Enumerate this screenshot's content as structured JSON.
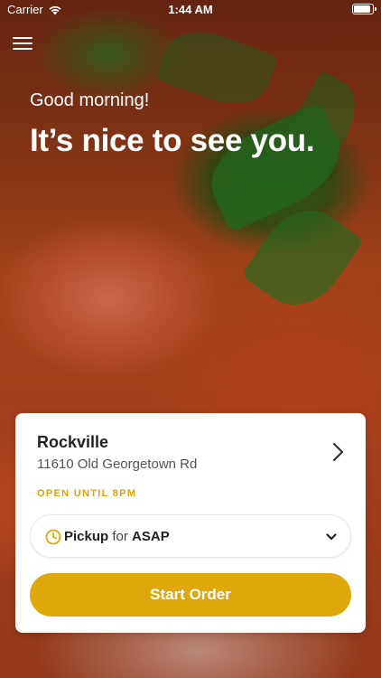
{
  "status_bar": {
    "carrier": "Carrier",
    "time": "1:44 AM",
    "battery_level": 0.9
  },
  "icons": {
    "menu": "hamburger-menu-icon",
    "wifi": "wifi-icon",
    "battery": "battery-icon",
    "chevron_right": "chevron-right-icon",
    "clock": "clock-icon",
    "chevron_down": "chevron-down-icon"
  },
  "hero": {
    "greeting": "Good morning!",
    "headline": "It’s nice to see you."
  },
  "location": {
    "name": "Rockville",
    "address": "11610 Old Georgetown Rd",
    "hours": "OPEN UNTIL 8PM"
  },
  "order": {
    "type": "Pickup",
    "connector": "for",
    "time": "ASAP"
  },
  "actions": {
    "start_order": "Start Order"
  },
  "colors": {
    "accent": "#e0a70b",
    "hours_text": "#d9a410"
  }
}
